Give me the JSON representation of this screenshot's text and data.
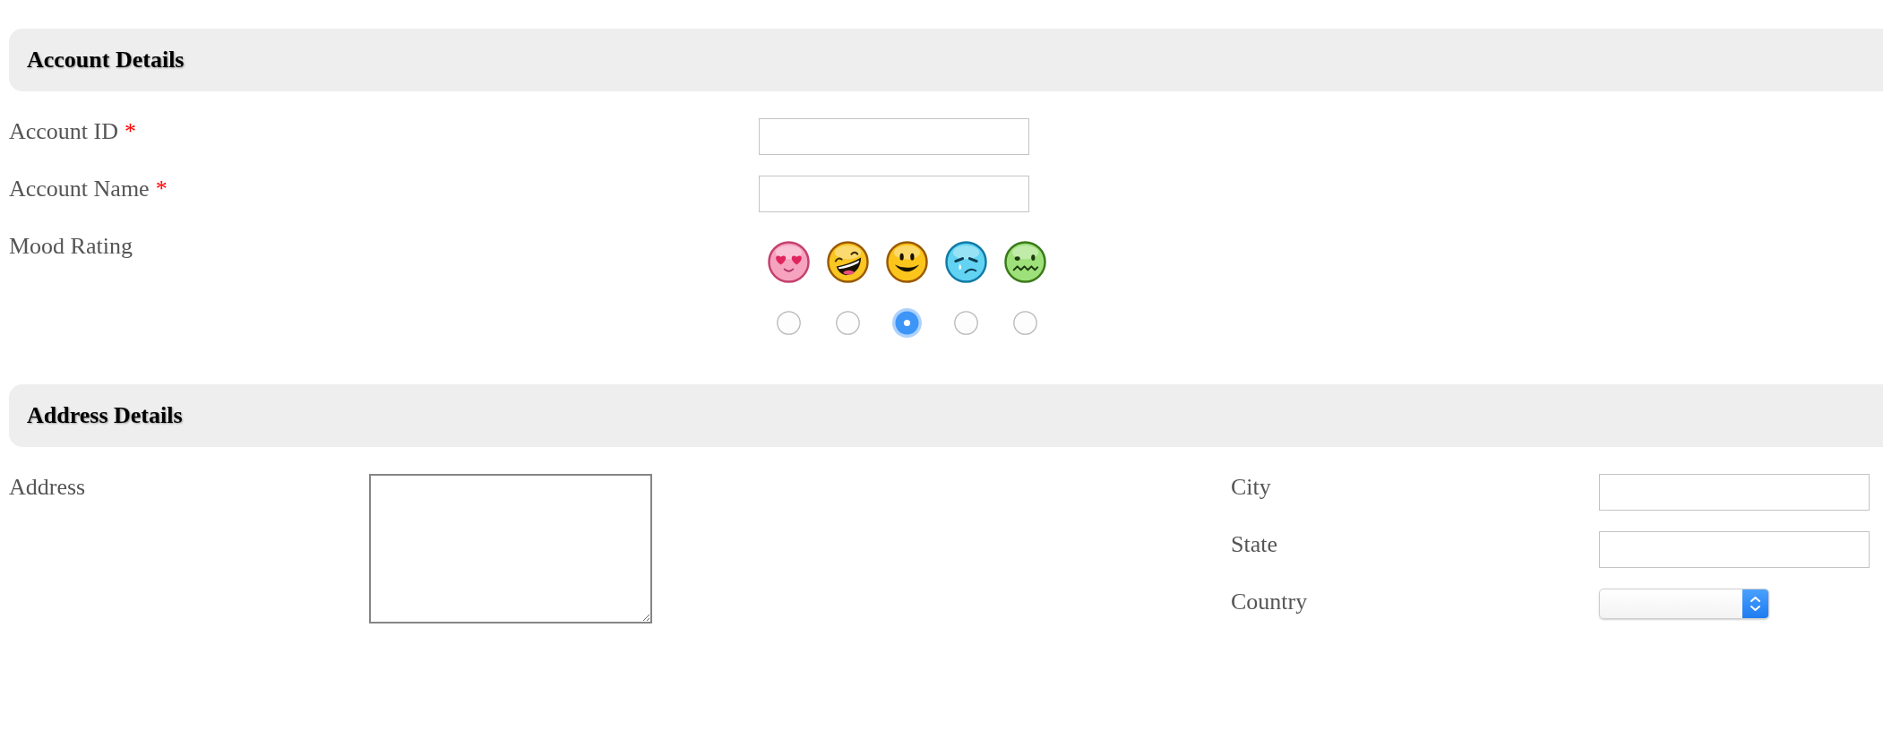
{
  "sections": [
    {
      "title": "Account Details",
      "columns": [
        {
          "fields": [
            {
              "kind": "text",
              "label": "Account ID",
              "required_mark": "*"
            },
            {
              "kind": "text",
              "label": "Account Name",
              "required_mark": "*"
            },
            {
              "kind": "mood",
              "label": "Mood Rating",
              "options": [
                {
                  "kind": "heart-eyes",
                  "selected": false
                },
                {
                  "kind": "laughing",
                  "selected": false
                },
                {
                  "kind": "smile",
                  "selected": true
                },
                {
                  "kind": "crying",
                  "selected": false
                },
                {
                  "kind": "sick",
                  "selected": false
                }
              ]
            }
          ]
        }
      ]
    },
    {
      "title": "Address Details",
      "columns": [
        {
          "fields": [
            {
              "kind": "textarea",
              "label": "Address"
            }
          ]
        },
        {
          "fields": [
            {
              "kind": "text",
              "label": "City"
            },
            {
              "kind": "text",
              "label": "State"
            },
            {
              "kind": "select",
              "label": "Country"
            }
          ]
        }
      ]
    }
  ]
}
